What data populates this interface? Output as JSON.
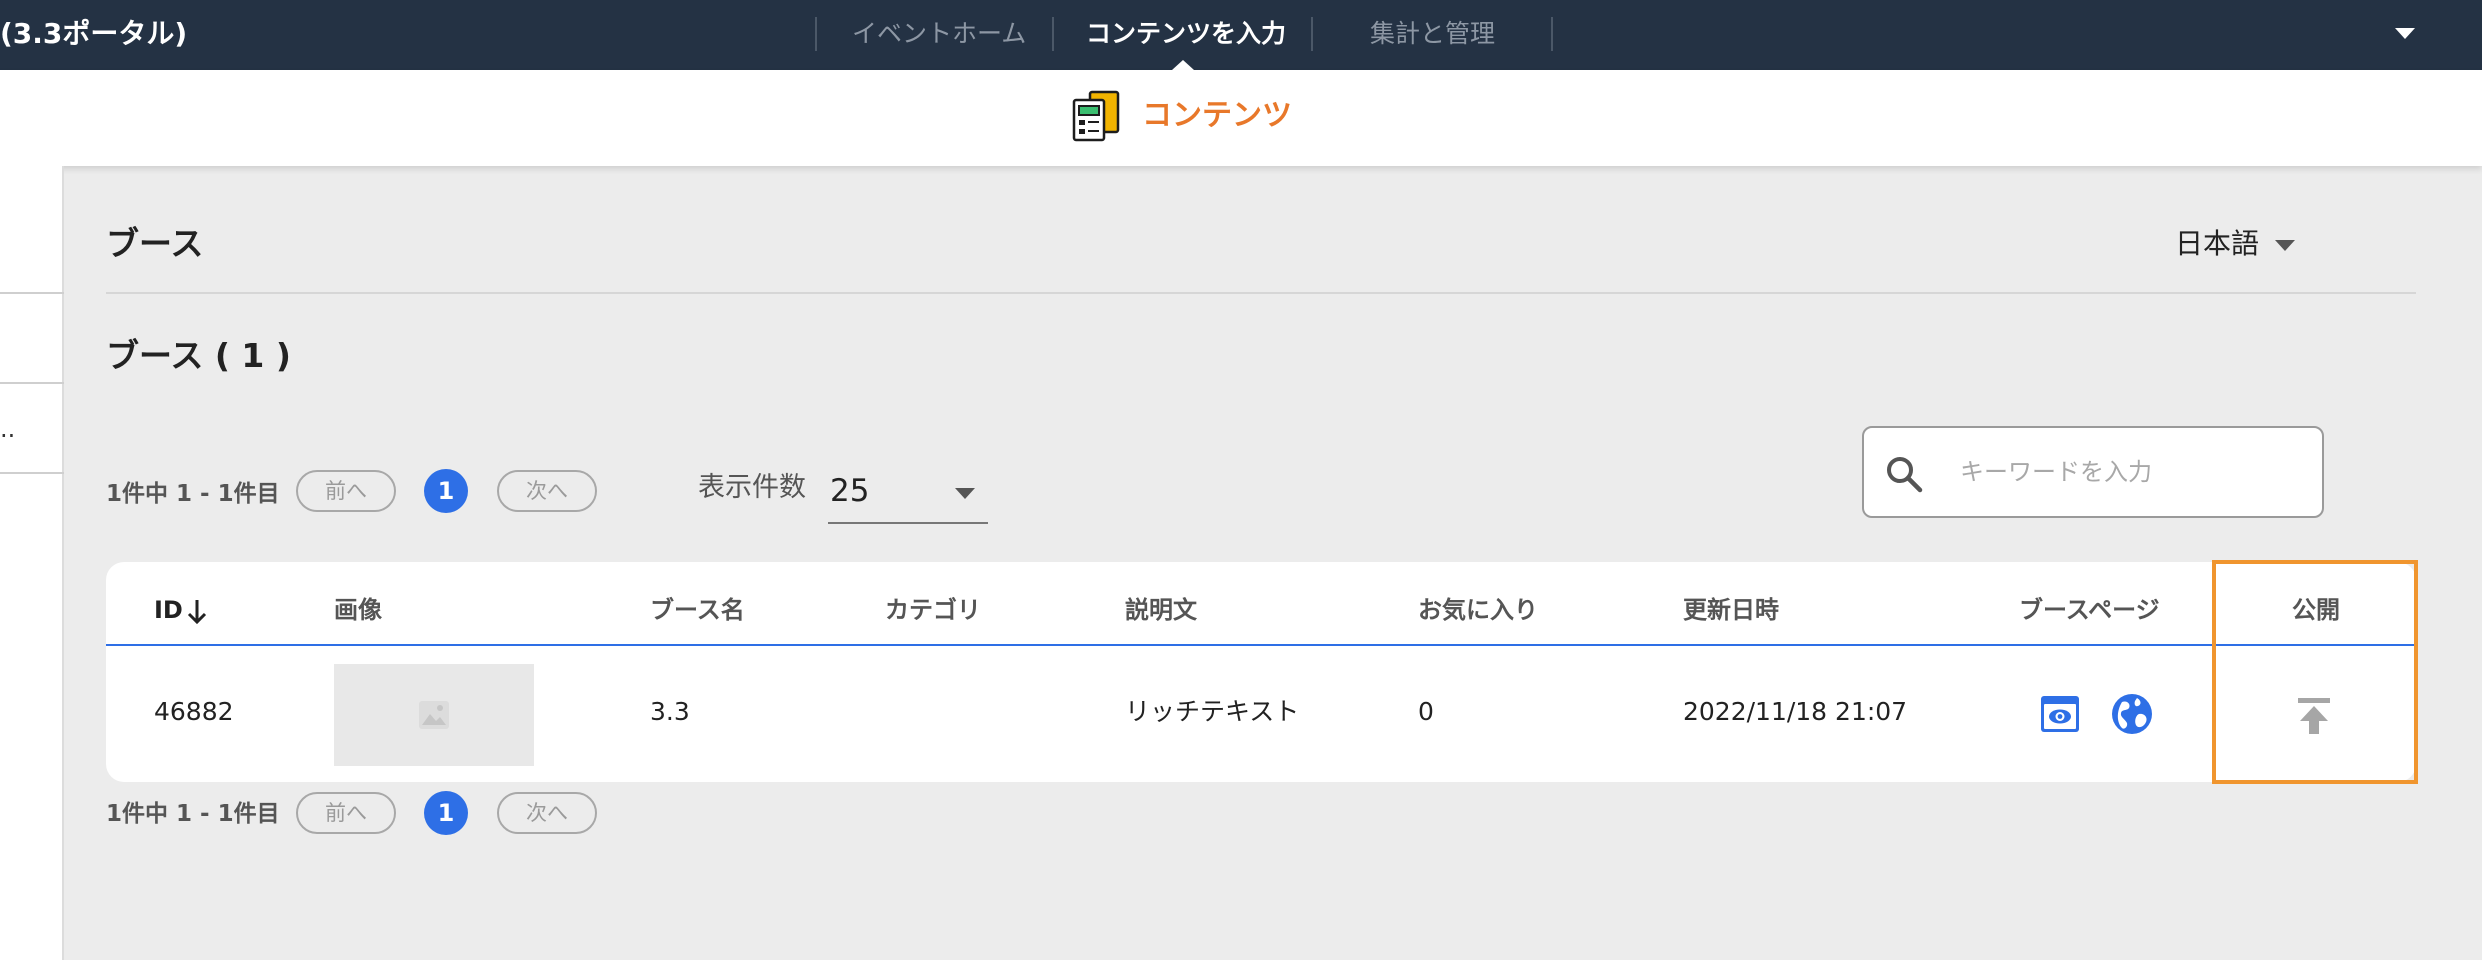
{
  "header": {
    "brand": "(3.3ポータル)",
    "nav": [
      {
        "label": "イベントホーム"
      },
      {
        "label": "コンテンツを入力"
      },
      {
        "label": "集計と管理"
      }
    ]
  },
  "subheader": {
    "title": "コンテンツ"
  },
  "main": {
    "section_title": "ブース",
    "language": "日本語",
    "count_title": "ブース ( 1 )",
    "pagination": {
      "info": "1件中 1 - 1件目",
      "prev": "前へ",
      "current_page": "1",
      "next": "次へ"
    },
    "per_page": {
      "label": "表示件数",
      "value": "25"
    },
    "search": {
      "placeholder": "キーワードを入力"
    }
  },
  "table": {
    "headers": [
      "ID",
      "画像",
      "ブース名",
      "カテゴリ",
      "説明文",
      "お気に入り",
      "更新日時",
      "ブースページ",
      "公開"
    ],
    "rows": [
      {
        "id": "46882",
        "name": "3.3",
        "category": "",
        "description": "リッチテキスト",
        "favorites": "0",
        "updated": "2022/11/18 21:07"
      }
    ]
  },
  "colors": {
    "topbar": "#243244",
    "accent_orange": "#e8782a",
    "primary_blue": "#2e6fe6",
    "highlight_border": "#f0952e"
  },
  "icons": {
    "content": "content-form-icon",
    "search": "search-icon",
    "sort": "arrow-down-icon",
    "preview": "preview-eye-icon",
    "globe": "globe-icon",
    "publish": "publish-upload-icon",
    "image_placeholder": "image-placeholder-icon"
  }
}
